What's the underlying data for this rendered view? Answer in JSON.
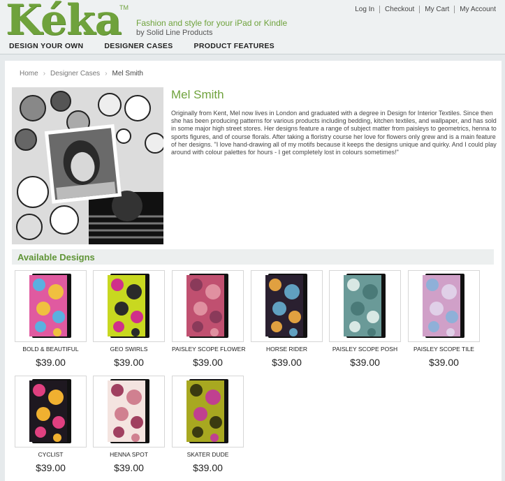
{
  "header": {
    "logo": "Kéka",
    "logo_tm": "TM",
    "tagline": "Fashion and style for your iPad or Kindle",
    "byline": "by Solid Line Products",
    "links": [
      "Log In",
      "Checkout",
      "My Cart",
      "My Account"
    ]
  },
  "nav": [
    "DESIGN YOUR OWN",
    "DESIGNER CASES",
    "PRODUCT FEATURES"
  ],
  "breadcrumb": {
    "home": "Home",
    "section": "Designer Cases",
    "current": "Mel Smith",
    "sep": "›"
  },
  "designer": {
    "name": "Mel Smith",
    "bio": "Originally from Kent, Mel now lives in London and graduated with a degree in Design for Interior Textiles.  Since then she has been producing patterns for various products including bedding, kitchen textiles, and wallpaper, and has sold in some major high street stores. Her designs feature a range of subject matter from paisleys to geometrics, henna to sports figures, and of course florals. After taking a floristry course her love for flowers only grew and is a main feature of her designs. \"I love hand-drawing all of my motifs because it keeps the designs unique and quirky. And I could play around with colour palettes for hours - I get completely lost in colours sometimes!\""
  },
  "available": {
    "title": "Available Designs",
    "products": [
      {
        "name": "BOLD & BEAUTIFUL",
        "price": "$39.00",
        "colors": [
          "#e05aa0",
          "#5ab0e0",
          "#f0c040"
        ]
      },
      {
        "name": "GEO SWIRLS",
        "price": "$39.00",
        "colors": [
          "#c8d820",
          "#d0308a",
          "#2a2a2a"
        ]
      },
      {
        "name": "PAISLEY SCOPE FLOWER",
        "price": "$39.00",
        "colors": [
          "#c05070",
          "#8a3a5a",
          "#e090a0"
        ]
      },
      {
        "name": "HORSE RIDER",
        "price": "$39.00",
        "colors": [
          "#2a2030",
          "#e0a040",
          "#60a0c0"
        ]
      },
      {
        "name": "PAISLEY SCOPE POSH",
        "price": "$39.00",
        "colors": [
          "#6a9a98",
          "#d8e8e4",
          "#4a7a78"
        ]
      },
      {
        "name": "PAISLEY SCOPE TILE",
        "price": "$39.00",
        "colors": [
          "#d0a0c8",
          "#8fb0d8",
          "#e0d0e8"
        ]
      },
      {
        "name": "CYCLIST",
        "price": "$39.00",
        "colors": [
          "#1e1820",
          "#e04080",
          "#f0b030"
        ]
      },
      {
        "name": "HENNA SPOT",
        "price": "$39.00",
        "colors": [
          "#f4e4e0",
          "#a04060",
          "#d08090"
        ]
      },
      {
        "name": "SKATER DUDE",
        "price": "$39.00",
        "colors": [
          "#a8a820",
          "#3a3a10",
          "#c04090"
        ]
      }
    ]
  }
}
